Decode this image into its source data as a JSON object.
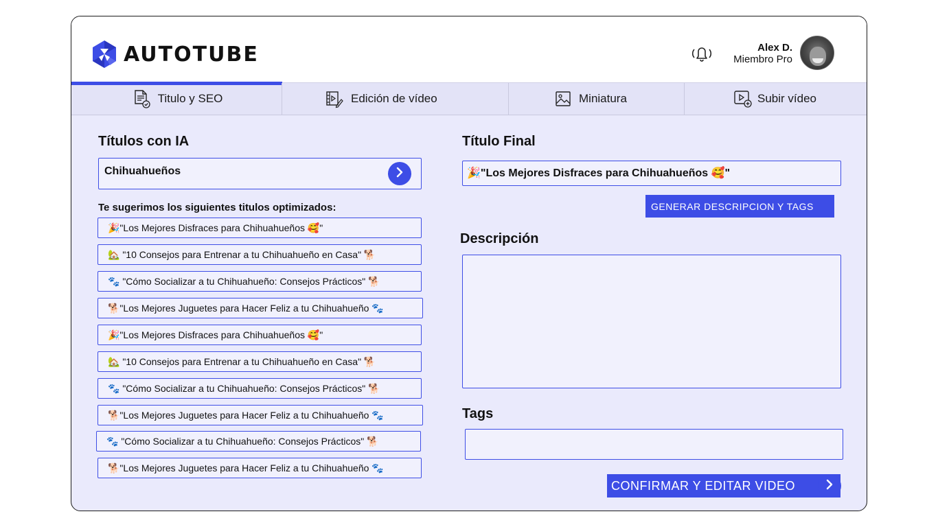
{
  "brand": {
    "name": "AUTOTUBE",
    "icon": "hexagon-logo-icon",
    "accent": "#3d4de6"
  },
  "header": {
    "bell_icon": "bell-ring-icon",
    "user_name": "Alex D.",
    "user_role": "Miembro Pro"
  },
  "tabs": [
    {
      "label": "Titulo y SEO",
      "icon": "document-check-icon",
      "active": true
    },
    {
      "label": "Edición de vídeo",
      "icon": "film-edit-icon",
      "active": false
    },
    {
      "label": "Miniatura",
      "icon": "image-icon",
      "active": false
    },
    {
      "label": "Subir vídeo",
      "icon": "upload-video-icon",
      "active": false
    }
  ],
  "left": {
    "title": "Títulos con IA",
    "topic_value": "Chihuahueños",
    "suggest_label": "Te sugerimos los siguientes titulos optimizados:",
    "suggestions": [
      "🎉\"Los Mejores Disfraces para Chihuahueños 🥰\"",
      "🏡 \"10 Consejos para Entrenar a tu Chihuahueño en Casa\" 🐕",
      "🐾 \"Cómo Socializar a tu Chihuahueño: Consejos Prácticos\" 🐕",
      "🐕\"Los Mejores Juguetes para Hacer Feliz a tu Chihuahueño 🐾",
      "🎉\"Los Mejores Disfraces para Chihuahueños 🥰\"",
      "🏡 \"10 Consejos para Entrenar a tu Chihuahueño en Casa\" 🐕",
      "🐾 \"Cómo Socializar a tu Chihuahueño: Consejos Prácticos\" 🐕",
      "🐕\"Los Mejores Juguetes para Hacer Feliz a tu Chihuahueño 🐾",
      "🐾 \"Cómo Socializar a tu Chihuahueño: Consejos Prácticos\" 🐕",
      "🐕\"Los Mejores Juguetes para Hacer Feliz a tu Chihuahueño 🐾"
    ]
  },
  "right": {
    "final_title_label": "Título Final",
    "final_title_value": "🎉\"Los Mejores Disfraces para Chihuahueños 🥰\"",
    "generate_button": "GENERAR  DESCRIPCION Y TAGS",
    "description_label": "Descripción",
    "description_value": "",
    "tags_label": "Tags",
    "tags_value": "",
    "confirm_button": "CONFIRMAR Y EDITAR VIDEO"
  }
}
